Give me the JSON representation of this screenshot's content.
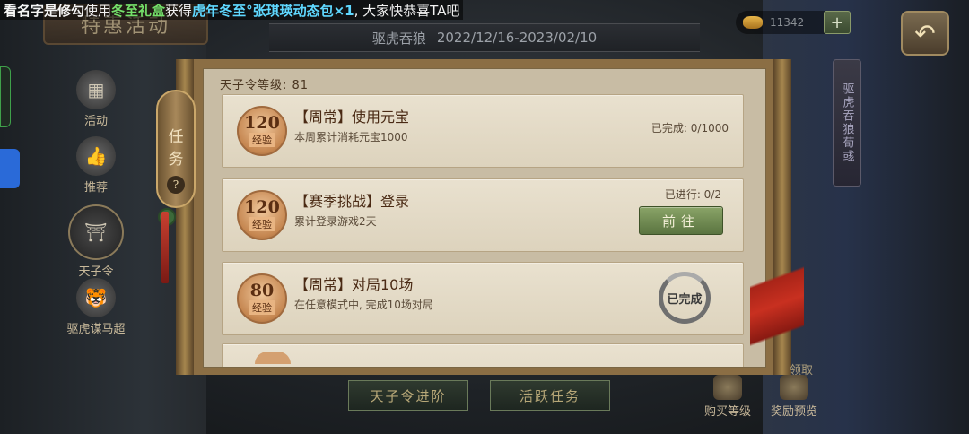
{
  "marquee": {
    "player_name": "看名字是修勾",
    "text1": "使用",
    "item1": "冬至礼盒",
    "text2": "获得",
    "item2": "虎年冬至°张琪瑛动态包×1",
    "text3": ", 大家快恭喜TA吧"
  },
  "header": {
    "banner": "特惠活动",
    "event_name": "驱虎吞狼",
    "event_dates": "2022/12/16-2023/02/10",
    "currency_amount": "11342",
    "plus_label": "+",
    "back_label": "↶"
  },
  "side_nav": {
    "items": [
      {
        "label": "活动",
        "icon": "gift-icon"
      },
      {
        "label": "推荐",
        "icon": "thumbs-up-icon"
      },
      {
        "label": "天子令",
        "icon": "emperor-token-icon"
      },
      {
        "label": "驱虎谋马超",
        "icon": "tiger-icon"
      }
    ]
  },
  "right_scroll": {
    "label": "驱虎吞狼荀彧"
  },
  "task_tag": {
    "label_1": "任",
    "label_2": "务",
    "help": "?"
  },
  "panel": {
    "level_line": "天子令等级: 81",
    "tasks": [
      {
        "exp": "120",
        "exp_label": "经验",
        "title": "【周常】使用元宝",
        "desc": "本周累计消耗元宝1000",
        "progress": "已完成: 0/1000"
      },
      {
        "exp": "120",
        "exp_label": "经验",
        "title": "【赛季挑战】登录",
        "desc": "累计登录游戏2天",
        "progress": "已进行: 0/2",
        "button": "前往"
      },
      {
        "exp": "80",
        "exp_label": "经验",
        "title": "【周常】对局10场",
        "desc": "在任意模式中, 完成10场对局",
        "stamp": "已完成"
      }
    ]
  },
  "bottom_tabs": [
    "天子令进阶",
    "活跃任务"
  ],
  "bottom_right": {
    "claim_text": "领取",
    "buy_level": "购买等级",
    "reward_preview": "奖励预览"
  },
  "colors": {
    "panel_bg": "#c8bca4",
    "card_bg": "#e9e1cf",
    "go_button": "#8aa468",
    "marquee_item1": "#74e06a",
    "marquee_item2": "#5fd8ff"
  }
}
